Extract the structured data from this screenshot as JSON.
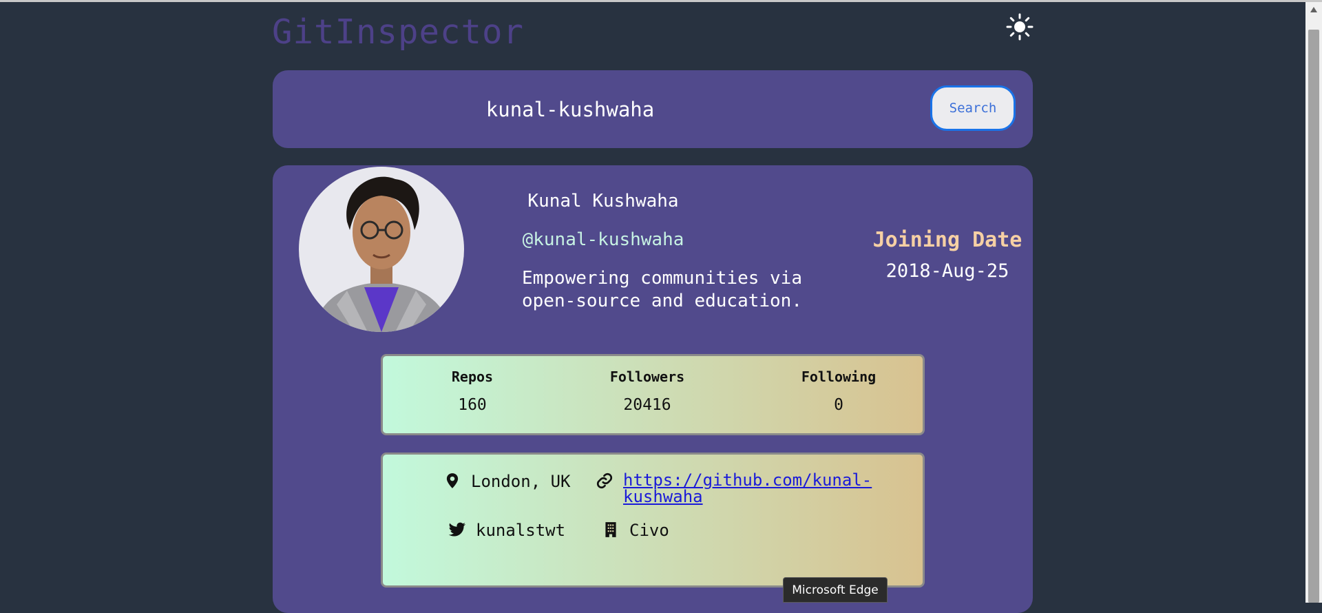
{
  "app": {
    "title": "GitInspector"
  },
  "search": {
    "value": "kunal-kushwaha",
    "button_label": "Search"
  },
  "profile": {
    "name": "Kunal Kushwaha",
    "login": "@kunal-kushwaha",
    "bio": "Empowering communities via open-source and education.",
    "joining_label": "Joining Date",
    "joining_date": "2018-Aug-25"
  },
  "stats": [
    {
      "label": "Repos",
      "value": "160"
    },
    {
      "label": "Followers",
      "value": "20416"
    },
    {
      "label": "Following",
      "value": "0"
    }
  ],
  "info": {
    "location": "London, UK",
    "blog_url": "https://github.com/kunal-kushwaha",
    "twitter": "kunalstwt",
    "company": "Civo"
  },
  "tooltip": {
    "text": "Microsoft Edge"
  },
  "icons": {
    "theme": "sun-icon",
    "location": "map-pin-icon",
    "link": "link-icon",
    "twitter": "twitter-icon",
    "company": "building-icon"
  },
  "colors": {
    "background": "#283240",
    "panel": "#514a8c",
    "brand": "#4d4188",
    "join_label": "#f6d0a4",
    "handle": "#c7f2e3",
    "card_gradient_start": "#c2f9dc",
    "card_gradient_end": "#d8c290",
    "search_button_border": "#1a73e8",
    "link": "#1a1ad8"
  }
}
